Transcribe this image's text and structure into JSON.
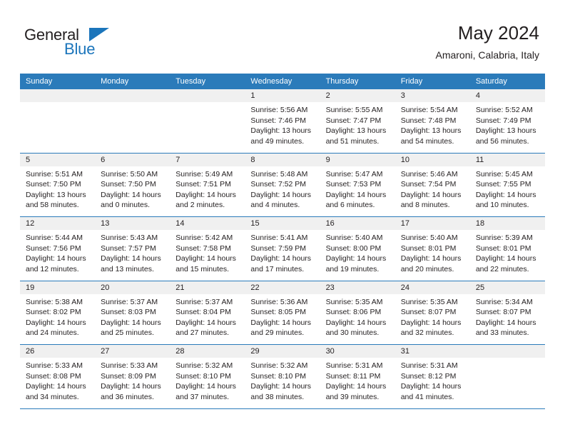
{
  "brand": {
    "name_part1": "General",
    "name_part2": "Blue"
  },
  "header": {
    "title": "May 2024",
    "subtitle": "Amaroni, Calabria, Italy"
  },
  "colors": {
    "accent": "#2b7bba",
    "logo_blue": "#1b75bb",
    "datebar": "#f0f0f0",
    "text": "#231f20"
  },
  "weekdays": [
    "Sunday",
    "Monday",
    "Tuesday",
    "Wednesday",
    "Thursday",
    "Friday",
    "Saturday"
  ],
  "labels": {
    "sunrise": "Sunrise:",
    "sunset": "Sunset:",
    "daylight": "Daylight:"
  },
  "weeks": [
    [
      {
        "day": "",
        "empty": true
      },
      {
        "day": "",
        "empty": true
      },
      {
        "day": "",
        "empty": true
      },
      {
        "day": "1",
        "sunrise": "Sunrise: 5:56 AM",
        "sunset": "Sunset: 7:46 PM",
        "daylight_line1": "Daylight: 13 hours",
        "daylight_line2": "and 49 minutes."
      },
      {
        "day": "2",
        "sunrise": "Sunrise: 5:55 AM",
        "sunset": "Sunset: 7:47 PM",
        "daylight_line1": "Daylight: 13 hours",
        "daylight_line2": "and 51 minutes."
      },
      {
        "day": "3",
        "sunrise": "Sunrise: 5:54 AM",
        "sunset": "Sunset: 7:48 PM",
        "daylight_line1": "Daylight: 13 hours",
        "daylight_line2": "and 54 minutes."
      },
      {
        "day": "4",
        "sunrise": "Sunrise: 5:52 AM",
        "sunset": "Sunset: 7:49 PM",
        "daylight_line1": "Daylight: 13 hours",
        "daylight_line2": "and 56 minutes."
      }
    ],
    [
      {
        "day": "5",
        "sunrise": "Sunrise: 5:51 AM",
        "sunset": "Sunset: 7:50 PM",
        "daylight_line1": "Daylight: 13 hours",
        "daylight_line2": "and 58 minutes."
      },
      {
        "day": "6",
        "sunrise": "Sunrise: 5:50 AM",
        "sunset": "Sunset: 7:50 PM",
        "daylight_line1": "Daylight: 14 hours",
        "daylight_line2": "and 0 minutes."
      },
      {
        "day": "7",
        "sunrise": "Sunrise: 5:49 AM",
        "sunset": "Sunset: 7:51 PM",
        "daylight_line1": "Daylight: 14 hours",
        "daylight_line2": "and 2 minutes."
      },
      {
        "day": "8",
        "sunrise": "Sunrise: 5:48 AM",
        "sunset": "Sunset: 7:52 PM",
        "daylight_line1": "Daylight: 14 hours",
        "daylight_line2": "and 4 minutes."
      },
      {
        "day": "9",
        "sunrise": "Sunrise: 5:47 AM",
        "sunset": "Sunset: 7:53 PM",
        "daylight_line1": "Daylight: 14 hours",
        "daylight_line2": "and 6 minutes."
      },
      {
        "day": "10",
        "sunrise": "Sunrise: 5:46 AM",
        "sunset": "Sunset: 7:54 PM",
        "daylight_line1": "Daylight: 14 hours",
        "daylight_line2": "and 8 minutes."
      },
      {
        "day": "11",
        "sunrise": "Sunrise: 5:45 AM",
        "sunset": "Sunset: 7:55 PM",
        "daylight_line1": "Daylight: 14 hours",
        "daylight_line2": "and 10 minutes."
      }
    ],
    [
      {
        "day": "12",
        "sunrise": "Sunrise: 5:44 AM",
        "sunset": "Sunset: 7:56 PM",
        "daylight_line1": "Daylight: 14 hours",
        "daylight_line2": "and 12 minutes."
      },
      {
        "day": "13",
        "sunrise": "Sunrise: 5:43 AM",
        "sunset": "Sunset: 7:57 PM",
        "daylight_line1": "Daylight: 14 hours",
        "daylight_line2": "and 13 minutes."
      },
      {
        "day": "14",
        "sunrise": "Sunrise: 5:42 AM",
        "sunset": "Sunset: 7:58 PM",
        "daylight_line1": "Daylight: 14 hours",
        "daylight_line2": "and 15 minutes."
      },
      {
        "day": "15",
        "sunrise": "Sunrise: 5:41 AM",
        "sunset": "Sunset: 7:59 PM",
        "daylight_line1": "Daylight: 14 hours",
        "daylight_line2": "and 17 minutes."
      },
      {
        "day": "16",
        "sunrise": "Sunrise: 5:40 AM",
        "sunset": "Sunset: 8:00 PM",
        "daylight_line1": "Daylight: 14 hours",
        "daylight_line2": "and 19 minutes."
      },
      {
        "day": "17",
        "sunrise": "Sunrise: 5:40 AM",
        "sunset": "Sunset: 8:01 PM",
        "daylight_line1": "Daylight: 14 hours",
        "daylight_line2": "and 20 minutes."
      },
      {
        "day": "18",
        "sunrise": "Sunrise: 5:39 AM",
        "sunset": "Sunset: 8:01 PM",
        "daylight_line1": "Daylight: 14 hours",
        "daylight_line2": "and 22 minutes."
      }
    ],
    [
      {
        "day": "19",
        "sunrise": "Sunrise: 5:38 AM",
        "sunset": "Sunset: 8:02 PM",
        "daylight_line1": "Daylight: 14 hours",
        "daylight_line2": "and 24 minutes."
      },
      {
        "day": "20",
        "sunrise": "Sunrise: 5:37 AM",
        "sunset": "Sunset: 8:03 PM",
        "daylight_line1": "Daylight: 14 hours",
        "daylight_line2": "and 25 minutes."
      },
      {
        "day": "21",
        "sunrise": "Sunrise: 5:37 AM",
        "sunset": "Sunset: 8:04 PM",
        "daylight_line1": "Daylight: 14 hours",
        "daylight_line2": "and 27 minutes."
      },
      {
        "day": "22",
        "sunrise": "Sunrise: 5:36 AM",
        "sunset": "Sunset: 8:05 PM",
        "daylight_line1": "Daylight: 14 hours",
        "daylight_line2": "and 29 minutes."
      },
      {
        "day": "23",
        "sunrise": "Sunrise: 5:35 AM",
        "sunset": "Sunset: 8:06 PM",
        "daylight_line1": "Daylight: 14 hours",
        "daylight_line2": "and 30 minutes."
      },
      {
        "day": "24",
        "sunrise": "Sunrise: 5:35 AM",
        "sunset": "Sunset: 8:07 PM",
        "daylight_line1": "Daylight: 14 hours",
        "daylight_line2": "and 32 minutes."
      },
      {
        "day": "25",
        "sunrise": "Sunrise: 5:34 AM",
        "sunset": "Sunset: 8:07 PM",
        "daylight_line1": "Daylight: 14 hours",
        "daylight_line2": "and 33 minutes."
      }
    ],
    [
      {
        "day": "26",
        "sunrise": "Sunrise: 5:33 AM",
        "sunset": "Sunset: 8:08 PM",
        "daylight_line1": "Daylight: 14 hours",
        "daylight_line2": "and 34 minutes."
      },
      {
        "day": "27",
        "sunrise": "Sunrise: 5:33 AM",
        "sunset": "Sunset: 8:09 PM",
        "daylight_line1": "Daylight: 14 hours",
        "daylight_line2": "and 36 minutes."
      },
      {
        "day": "28",
        "sunrise": "Sunrise: 5:32 AM",
        "sunset": "Sunset: 8:10 PM",
        "daylight_line1": "Daylight: 14 hours",
        "daylight_line2": "and 37 minutes."
      },
      {
        "day": "29",
        "sunrise": "Sunrise: 5:32 AM",
        "sunset": "Sunset: 8:10 PM",
        "daylight_line1": "Daylight: 14 hours",
        "daylight_line2": "and 38 minutes."
      },
      {
        "day": "30",
        "sunrise": "Sunrise: 5:31 AM",
        "sunset": "Sunset: 8:11 PM",
        "daylight_line1": "Daylight: 14 hours",
        "daylight_line2": "and 39 minutes."
      },
      {
        "day": "31",
        "sunrise": "Sunrise: 5:31 AM",
        "sunset": "Sunset: 8:12 PM",
        "daylight_line1": "Daylight: 14 hours",
        "daylight_line2": "and 41 minutes."
      },
      {
        "day": "",
        "empty": true
      }
    ]
  ]
}
